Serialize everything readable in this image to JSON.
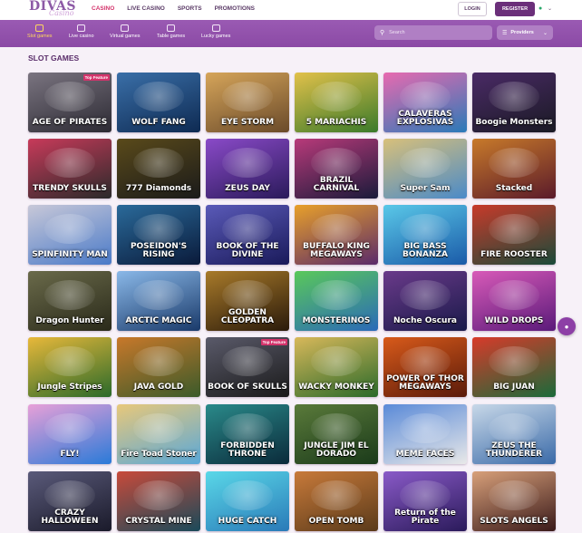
{
  "logo": {
    "line1": "DIVAS",
    "line2": "Casino"
  },
  "nav": [
    {
      "label": "CASINO",
      "active": true
    },
    {
      "label": "LIVE CASINO",
      "active": false
    },
    {
      "label": "SPORTS",
      "active": false
    },
    {
      "label": "PROMOTIONS",
      "active": false
    }
  ],
  "header": {
    "login_label": "LOGIN",
    "register_label": "REGISTER",
    "globe_icon": "globe-icon"
  },
  "categories": [
    {
      "label": "Slot games",
      "icon": "slot-icon",
      "active": true
    },
    {
      "label": "Live casino",
      "icon": "live-icon",
      "active": false
    },
    {
      "label": "Virtual games",
      "icon": "virtual-icon",
      "active": false
    },
    {
      "label": "Table games",
      "icon": "table-icon",
      "active": false
    },
    {
      "label": "Lucky games",
      "icon": "lucky-icon",
      "active": false
    }
  ],
  "search": {
    "placeholder": "Search"
  },
  "providers": {
    "label": "Providers"
  },
  "section": {
    "title": "SLOT GAMES"
  },
  "games": [
    {
      "title": "AGE OF PIRATES",
      "badge": "Top Feature",
      "colors": [
        "#2c2a33",
        "#7a7480"
      ]
    },
    {
      "title": "WOLF FANG",
      "badge": "",
      "colors": [
        "#0e2a52",
        "#3a6fa8"
      ]
    },
    {
      "title": "EYE STORM",
      "badge": "",
      "colors": [
        "#6a4a2a",
        "#d6a55a"
      ]
    },
    {
      "title": "5 MARIACHIS",
      "badge": "",
      "colors": [
        "#3a7a2a",
        "#e2c14a"
      ]
    },
    {
      "title": "CALAVERAS EXPLOSIVAS",
      "badge": "",
      "colors": [
        "#2a7ab8",
        "#e86ab0"
      ]
    },
    {
      "title": "Boogie Monsters",
      "badge": "",
      "colors": [
        "#1a1a24",
        "#4a2a66"
      ]
    },
    {
      "title": "TRENDY SKULLS",
      "badge": "",
      "colors": [
        "#2a2a2a",
        "#c83a5a"
      ]
    },
    {
      "title": "777 Diamonds",
      "badge": "",
      "colors": [
        "#1a1a1a",
        "#5a4a1a"
      ]
    },
    {
      "title": "ZEUS DAY",
      "badge": "",
      "colors": [
        "#2a1a5a",
        "#8a4ac8"
      ]
    },
    {
      "title": "BRAZIL CARNIVAL",
      "badge": "",
      "colors": [
        "#1a1a3a",
        "#b83a7a"
      ]
    },
    {
      "title": "Super Sam",
      "badge": "",
      "colors": [
        "#4a8ac8",
        "#d8c07a"
      ]
    },
    {
      "title": "Stacked",
      "badge": "",
      "colors": [
        "#5a1a2a",
        "#c87a2a"
      ]
    },
    {
      "title": "SPINFINITY MAN",
      "badge": "",
      "colors": [
        "#4a7ac8",
        "#c8c8d8"
      ]
    },
    {
      "title": "POSEIDON'S RISING",
      "badge": "",
      "colors": [
        "#0a1a3a",
        "#2a6a9a"
      ]
    },
    {
      "title": "BOOK OF THE DIVINE",
      "badge": "",
      "colors": [
        "#1a1a5a",
        "#5a5ab8"
      ]
    },
    {
      "title": "BUFFALO KING MEGAWAYS",
      "badge": "",
      "colors": [
        "#5a2a6a",
        "#e8a02a"
      ]
    },
    {
      "title": "BIG BASS BONANZA",
      "badge": "",
      "colors": [
        "#1a5aa8",
        "#5ac8e8"
      ]
    },
    {
      "title": "FIRE ROOSTER",
      "badge": "",
      "colors": [
        "#1a4a3a",
        "#c83a2a"
      ]
    },
    {
      "title": "Dragon Hunter",
      "badge": "",
      "colors": [
        "#2a2a1a",
        "#6a6a4a"
      ]
    },
    {
      "title": "ARCTIC MAGIC",
      "badge": "",
      "colors": [
        "#1a3a6a",
        "#8ab8e8"
      ]
    },
    {
      "title": "GOLDEN CLEOPATRA",
      "badge": "",
      "colors": [
        "#2a1a0a",
        "#a87a2a"
      ]
    },
    {
      "title": "MONSTERINOS",
      "badge": "",
      "colors": [
        "#2a6ab8",
        "#5ac85a"
      ]
    },
    {
      "title": "Noche Oscura",
      "badge": "",
      "colors": [
        "#1a1a4a",
        "#6a3a8a"
      ]
    },
    {
      "title": "WILD DROPS",
      "badge": "",
      "colors": [
        "#5a1a7a",
        "#d85ab8"
      ]
    },
    {
      "title": "Jungle Stripes",
      "badge": "",
      "colors": [
        "#2a6a2a",
        "#e8b83a"
      ]
    },
    {
      "title": "JAVA GOLD",
      "badge": "",
      "colors": [
        "#3a5a2a",
        "#c8782a"
      ]
    },
    {
      "title": "BOOK OF SKULLS",
      "badge": "Top Feature",
      "colors": [
        "#1a1a1a",
        "#5a5a6a"
      ]
    },
    {
      "title": "WACKY MONKEY",
      "badge": "",
      "colors": [
        "#2a6a2a",
        "#d8b85a"
      ]
    },
    {
      "title": "POWER OF THOR MEGAWAYS",
      "badge": "",
      "colors": [
        "#5a1a0a",
        "#d85a1a"
      ]
    },
    {
      "title": "BIG JUAN",
      "badge": "",
      "colors": [
        "#1a6a3a",
        "#d83a2a"
      ]
    },
    {
      "title": "FLY!",
      "badge": "",
      "colors": [
        "#2a7ad8",
        "#e8a0d8"
      ]
    },
    {
      "title": "Fire Toad Stoner",
      "badge": "",
      "colors": [
        "#5aa8d8",
        "#e8c87a"
      ]
    },
    {
      "title": "FORBIDDEN THRONE",
      "badge": "",
      "colors": [
        "#0a2a3a",
        "#2a8a8a"
      ]
    },
    {
      "title": "JUNGLE JIM EL DORADO",
      "badge": "",
      "colors": [
        "#1a3a1a",
        "#5a7a3a"
      ]
    },
    {
      "title": "MEME FACES",
      "badge": "",
      "colors": [
        "#e8e8e8",
        "#5a8ad8"
      ]
    },
    {
      "title": "ZEUS THE THUNDERER",
      "badge": "",
      "colors": [
        "#3a6aa8",
        "#c8d8e8"
      ]
    },
    {
      "title": "CRAZY HALLOWEEN",
      "badge": "",
      "colors": [
        "#1a1a2a",
        "#5a5a7a"
      ]
    },
    {
      "title": "CRYSTAL MINE",
      "badge": "",
      "colors": [
        "#1a4a5a",
        "#c84a3a"
      ]
    },
    {
      "title": "HUGE CATCH",
      "badge": "",
      "colors": [
        "#2a7ab8",
        "#5ad8e8"
      ]
    },
    {
      "title": "OPEN TOMB",
      "badge": "",
      "colors": [
        "#5a3a1a",
        "#c87a3a"
      ]
    },
    {
      "title": "Return of the Pirate",
      "badge": "",
      "colors": [
        "#2a1a5a",
        "#8a5ac8"
      ]
    },
    {
      "title": "SLOTS ANGELS",
      "badge": "",
      "colors": [
        "#3a1a1a",
        "#d8a07a"
      ]
    }
  ],
  "fab": {
    "icon": "chat-icon"
  }
}
